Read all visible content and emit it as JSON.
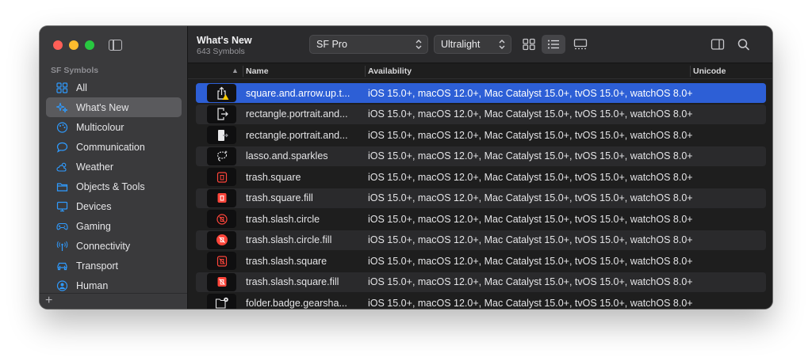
{
  "sidebar": {
    "section_title": "SF Symbols",
    "items": [
      {
        "label": "All",
        "icon": "grid-icon",
        "selected": false
      },
      {
        "label": "What's New",
        "icon": "sparkles-icon",
        "selected": true
      },
      {
        "label": "Multicolour",
        "icon": "palette-icon",
        "selected": false
      },
      {
        "label": "Communication",
        "icon": "speech-bubble-icon",
        "selected": false
      },
      {
        "label": "Weather",
        "icon": "cloud-sun-icon",
        "selected": false
      },
      {
        "label": "Objects & Tools",
        "icon": "folder-icon",
        "selected": false
      },
      {
        "label": "Devices",
        "icon": "desktop-icon",
        "selected": false
      },
      {
        "label": "Gaming",
        "icon": "gamecontroller-icon",
        "selected": false
      },
      {
        "label": "Connectivity",
        "icon": "antenna-icon",
        "selected": false
      },
      {
        "label": "Transport",
        "icon": "car-icon",
        "selected": false
      },
      {
        "label": "Human",
        "icon": "person-icon",
        "selected": false
      }
    ],
    "add_label": "+"
  },
  "toolbar": {
    "title": "What's New",
    "subtitle": "643 Symbols",
    "font_select": "SF Pro",
    "weight_select": "Ultralight",
    "view_modes": [
      "grid-view-icon",
      "list-view-icon",
      "gallery-view-icon"
    ],
    "active_view": "list-view-icon"
  },
  "table": {
    "columns": {
      "name": "Name",
      "availability": "Availability",
      "unicode": "Unicode"
    },
    "rows": [
      {
        "name": "square.and.arrow.up.t...",
        "availability": "iOS 15.0+, macOS 12.0+, Mac Catalyst 15.0+, tvOS 15.0+, watchOS 8.0+",
        "icon": "share-warning-icon"
      },
      {
        "name": "rectangle.portrait.and...",
        "availability": "iOS 15.0+, macOS 12.0+, Mac Catalyst 15.0+, tvOS 15.0+, watchOS 8.0+",
        "icon": "rectangle-arrow-icon"
      },
      {
        "name": "rectangle.portrait.and...",
        "availability": "iOS 15.0+, macOS 12.0+, Mac Catalyst 15.0+, tvOS 15.0+, watchOS 8.0+",
        "icon": "rectangle-arrow-fill-icon"
      },
      {
        "name": "lasso.and.sparkles",
        "availability": "iOS 15.0+, macOS 12.0+, Mac Catalyst 15.0+, tvOS 15.0+, watchOS 8.0+",
        "icon": "lasso-icon"
      },
      {
        "name": "trash.square",
        "availability": "iOS 15.0+, macOS 12.0+, Mac Catalyst 15.0+, tvOS 15.0+, watchOS 8.0+",
        "icon": "trash-square-icon"
      },
      {
        "name": "trash.square.fill",
        "availability": "iOS 15.0+, macOS 12.0+, Mac Catalyst 15.0+, tvOS 15.0+, watchOS 8.0+",
        "icon": "trash-square-fill-icon"
      },
      {
        "name": "trash.slash.circle",
        "availability": "iOS 15.0+, macOS 12.0+, Mac Catalyst 15.0+, tvOS 15.0+, watchOS 8.0+",
        "icon": "trash-slash-circle-icon"
      },
      {
        "name": "trash.slash.circle.fill",
        "availability": "iOS 15.0+, macOS 12.0+, Mac Catalyst 15.0+, tvOS 15.0+, watchOS 8.0+",
        "icon": "trash-slash-circle-fill-icon"
      },
      {
        "name": "trash.slash.square",
        "availability": "iOS 15.0+, macOS 12.0+, Mac Catalyst 15.0+, tvOS 15.0+, watchOS 8.0+",
        "icon": "trash-slash-square-icon"
      },
      {
        "name": "trash.slash.square.fill",
        "availability": "iOS 15.0+, macOS 12.0+, Mac Catalyst 15.0+, tvOS 15.0+, watchOS 8.0+",
        "icon": "trash-slash-square-fill-icon"
      },
      {
        "name": "folder.badge.gearsha...",
        "availability": "iOS 15.0+, macOS 12.0+, Mac Catalyst 15.0+, tvOS 15.0+, watchOS 8.0+",
        "icon": "folder-gear-icon"
      }
    ]
  },
  "colors": {
    "accent": "#2d5fd6",
    "sidebar_icon": "#2f9bff",
    "trash_red": "#ff453a"
  }
}
